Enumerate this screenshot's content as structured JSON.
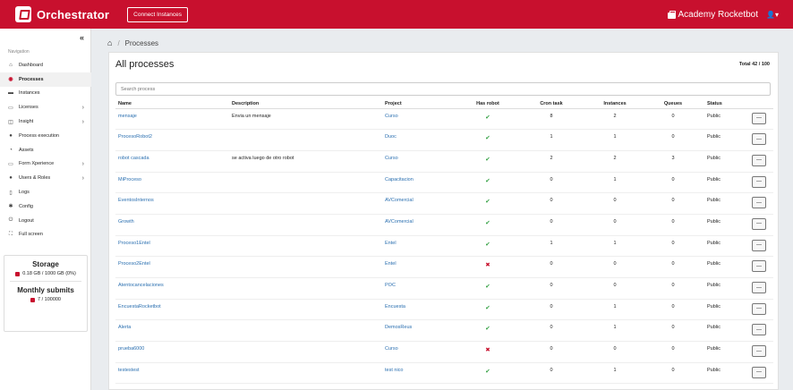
{
  "header": {
    "app_name": "Orchestrator",
    "connect_label": "Connect Instances",
    "account_name": "Academy Rocketbot",
    "user_menu_glyph": "👤▾"
  },
  "sidebar": {
    "collapse_glyph": "«",
    "heading": "Navigation",
    "items": [
      {
        "label": "Dashboard",
        "icon": "home-icon",
        "glyph": "⌂"
      },
      {
        "label": "Processes",
        "icon": "database-icon",
        "glyph": "◉",
        "active": true
      },
      {
        "label": "Instances",
        "icon": "server-icon",
        "glyph": "▬"
      },
      {
        "label": "Licenses",
        "icon": "license-icon",
        "glyph": "▭",
        "chevron": true
      },
      {
        "label": "Insight",
        "icon": "chart-icon",
        "glyph": "◫",
        "chevron": true
      },
      {
        "label": "Process execution",
        "icon": "execution-icon",
        "glyph": "●"
      },
      {
        "label": "Assets",
        "icon": "assets-icon",
        "glyph": "◔"
      },
      {
        "label": "Form Xperience",
        "icon": "form-icon",
        "glyph": "▭",
        "chevron": true
      },
      {
        "label": "Users & Roles",
        "icon": "users-icon",
        "glyph": "●",
        "chevron": true
      },
      {
        "label": "Logs",
        "icon": "logs-icon",
        "glyph": "▯"
      },
      {
        "label": "Config",
        "icon": "gear-icon",
        "glyph": "✱"
      },
      {
        "label": "Logout",
        "icon": "power-icon",
        "glyph": "⏻"
      },
      {
        "label": "Full screen",
        "icon": "fullscreen-icon",
        "glyph": "⛶"
      }
    ],
    "chevron_glyph": "›"
  },
  "stats": {
    "storage_title": "Storage",
    "storage_value": "0.18 GB / 1000 GB (0%)",
    "monthly_title": "Monthly submits",
    "monthly_value": "7 / 100000"
  },
  "breadcrumb": {
    "home_glyph": "⌂",
    "separator": "/",
    "current": "Processes"
  },
  "main": {
    "title": "All processes",
    "total": "Total 42 / 100",
    "search_placeholder": "Search process",
    "columns": [
      "Name",
      "Description",
      "Project",
      "Has robot",
      "Cron task",
      "Instances",
      "Queues",
      "Status"
    ],
    "check_glyph": "✔",
    "cross_glyph": "✖",
    "menu_glyph": "—",
    "rows": [
      {
        "name": "mensaje",
        "description": "Envia un mensaje",
        "project": "Curso",
        "has_robot": true,
        "cron": "8",
        "instances": "2",
        "queues": "0",
        "status": "Public"
      },
      {
        "name": "ProcesoRobot2",
        "description": "",
        "project": "Duoc",
        "has_robot": true,
        "cron": "1",
        "instances": "1",
        "queues": "0",
        "status": "Public"
      },
      {
        "name": "robot cascada",
        "description": "se activa luego de otro robot",
        "project": "Curso",
        "has_robot": true,
        "cron": "2",
        "instances": "2",
        "queues": "3",
        "status": "Public"
      },
      {
        "name": "MiProceso",
        "description": "",
        "project": "Capacitacion",
        "has_robot": true,
        "cron": "0",
        "instances": "1",
        "queues": "0",
        "status": "Public"
      },
      {
        "name": "EventosInternos",
        "description": "",
        "project": "AVComercial",
        "has_robot": true,
        "cron": "0",
        "instances": "0",
        "queues": "0",
        "status": "Public"
      },
      {
        "name": "Growth",
        "description": "",
        "project": "AVComercial",
        "has_robot": true,
        "cron": "0",
        "instances": "0",
        "queues": "0",
        "status": "Public"
      },
      {
        "name": "Proceso1Entel",
        "description": "",
        "project": "Entel",
        "has_robot": true,
        "cron": "1",
        "instances": "1",
        "queues": "0",
        "status": "Public"
      },
      {
        "name": "Proceso2Entel",
        "description": "",
        "project": "Entel",
        "has_robot": false,
        "cron": "0",
        "instances": "0",
        "queues": "0",
        "status": "Public"
      },
      {
        "name": "Atentocancelaciones",
        "description": "",
        "project": "POC",
        "has_robot": true,
        "cron": "0",
        "instances": "0",
        "queues": "0",
        "status": "Public"
      },
      {
        "name": "EncuestaRocketbot",
        "description": "",
        "project": "Encuesta",
        "has_robot": true,
        "cron": "0",
        "instances": "1",
        "queues": "0",
        "status": "Public"
      },
      {
        "name": "Alerta",
        "description": "",
        "project": "DemosReus",
        "has_robot": true,
        "cron": "0",
        "instances": "1",
        "queues": "0",
        "status": "Public"
      },
      {
        "name": "prueba6000",
        "description": "",
        "project": "Curso",
        "has_robot": false,
        "cron": "0",
        "instances": "0",
        "queues": "0",
        "status": "Public"
      },
      {
        "name": "testestest",
        "description": "",
        "project": "test nico",
        "has_robot": true,
        "cron": "0",
        "instances": "1",
        "queues": "0",
        "status": "Public"
      }
    ]
  },
  "colors": {
    "brand": "#c8102e",
    "link": "#2a6fb0",
    "check": "#2e9e3e"
  }
}
